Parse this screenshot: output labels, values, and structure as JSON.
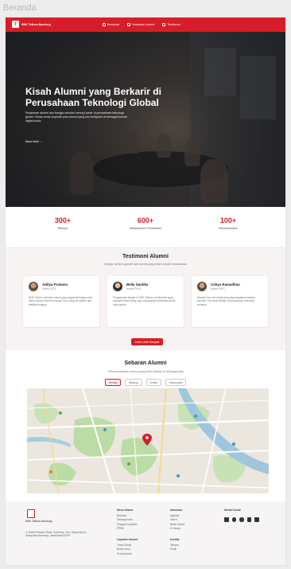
{
  "frame_title": "Beranda",
  "nav": {
    "logo_text": "SMK Telkom Bandung",
    "links": [
      {
        "label": "Beranda",
        "icon": "home-icon"
      },
      {
        "label": "Sebaran Alumni",
        "icon": "map-icon"
      },
      {
        "label": "Testimoni",
        "icon": "chat-icon"
      }
    ]
  },
  "hero": {
    "title": "Kisah Alumni yang Berkarir di Perusahaan Teknologi Global",
    "description": "Perjalanan alumni dari bangku sekolah menuju karier di perusahaan teknologi global. Simak cerita inspiratif para alumni yang kini berkiprah di berbagai industri digital dunia.",
    "link_label": "Baca lebih →"
  },
  "stats": [
    {
      "value": "300+",
      "label": "Bekerja"
    },
    {
      "value": "600+",
      "label": "Melanjutkan Pendidikan"
    },
    {
      "value": "100+",
      "label": "Berwirausaha"
    }
  ],
  "testimoni": {
    "title": "Testimoni Alumni",
    "subtitle": "Dengar cerita inspiratif dari alumni yang telah meraih kesuksesan",
    "cards": [
      {
        "name": "Aditya Pratama",
        "role": "Alumni 2020",
        "quote": "SMK Telkom memberi bekal yang sangat berharga untuk karier saya di dunia teknologi. Guru yang kompeten dan fasilitas lengkap."
      },
      {
        "name": "Bella Santika",
        "role": "Alumni 2019",
        "quote": "Pengalaman belajar di SMK Telkom membentuk saya menjadi pribadi yang siap menghadapi tantangan dunia kerja global."
      },
      {
        "name": "Cahya Ramadhan",
        "role": "Alumni 2021",
        "quote": "Banyak ilmu dan relasi yang saya dapatkan selama sekolah. Kini saya bekerja di perusahaan teknologi ternama."
      }
    ],
    "button_label": "Lihat Lebih Banyak"
  },
  "sebaran": {
    "title": "Sebaran Alumni",
    "subtitle": "Peta persebaran alumni yang telah bekerja di berbagai kota",
    "filters": [
      "Semua",
      "Bekerja",
      "Kuliah",
      "Wirausaha"
    ],
    "active_filter": "Semua"
  },
  "footer": {
    "logo_text": "SMK Telkom Bandung",
    "address": "Jl. Radio Palasari Road, Citeureup, Kec. Dayeuhkolot, Kabupaten Bandung, Jawa Barat 40257",
    "columns": [
      {
        "heading": "Menu Utama",
        "items": [
          "Beranda",
          "Tentang Kami",
          "Program Keahlian",
          "PPDB"
        ]
      },
      {
        "heading": "Informasi",
        "items": [
          "Agenda",
          "Galeri",
          "Berita Terkini",
          "E-Library"
        ]
      },
      {
        "heading": "Layanan Alumni",
        "items": [
          "Tracer Study",
          "Bursa Kerja",
          "Portal Alumni"
        ]
      },
      {
        "heading": "Kontak",
        "items": [
          "Telepon",
          "Email"
        ]
      }
    ],
    "social_heading": "Media Sosial",
    "social_icons": [
      "youtube-icon",
      "instagram-icon",
      "facebook-icon",
      "tiktok-icon",
      "twitter-icon"
    ]
  },
  "colors": {
    "brand_red": "#d71e28",
    "map_green": "#bcdca6",
    "map_water": "#9fc6dd"
  }
}
